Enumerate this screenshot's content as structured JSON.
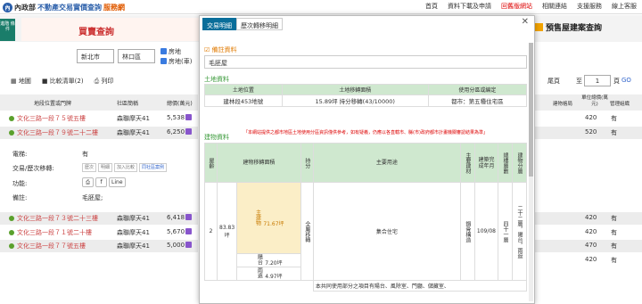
{
  "site": {
    "emblem": "內",
    "name_a": "內政部",
    "name_b": "不動產交易實價查詢",
    "name_c": "服務網"
  },
  "topnav": [
    "首頁",
    "資料下載及申請",
    "回舊版網站",
    "相關連結",
    "支援服務",
    "線上客服"
  ],
  "side_button": "進階\n條件",
  "banner": {
    "title": "買賣查詢",
    "presale": "預售屋建案查詢"
  },
  "filters": {
    "city": "新北市",
    "district": "林口區",
    "chk1": "房地",
    "chk2": "房地(車)"
  },
  "toolbar": {
    "map": "地圖",
    "compare": "比較清單(2)",
    "print": "列印"
  },
  "table_headers": {
    "address": "地段位置或門牌",
    "community": "社區簡稱",
    "price": "總價(萬元)"
  },
  "rows": [
    {
      "addr": "文化三路一段７５號五樓",
      "comm": "森聯摩天41",
      "price": "5,538"
    },
    {
      "addr": "文化三路一段７９號二十二樓",
      "comm": "森聯摩天41",
      "price": "6,250"
    },
    {
      "addr": "文化三路一段７３號二十三樓",
      "comm": "森聯摩天41",
      "price": "6,418"
    },
    {
      "addr": "文化三路一段７１號二十樓",
      "comm": "森聯摩天41",
      "price": "5,670"
    },
    {
      "addr": "文化三路一段７７號五樓",
      "comm": "森聯摩天41",
      "price": "5,000"
    }
  ],
  "detail": {
    "elevator_label": "電梯:",
    "elevator_value": "有",
    "history_label": "交易/歷次移轉:",
    "history_btns": [
      "歷次",
      "明細",
      "加入比較",
      "同社區案例"
    ],
    "func_label": "功能:",
    "line": "Line",
    "note_label": "備註:",
    "note_value": "毛胚屋;"
  },
  "right": {
    "last": "尾頁",
    "to": "至",
    "page": "1",
    "unit": "頁",
    "go": "GO",
    "h1": "建物格局",
    "h2": "單位總價(萬元)",
    "h3": "管理組織",
    "rows": [
      [
        "420",
        "有"
      ],
      [
        "520",
        "有"
      ],
      [
        "420",
        "有"
      ],
      [
        "420",
        "有"
      ],
      [
        "470",
        "有"
      ],
      [
        "420",
        "有"
      ]
    ]
  },
  "modal": {
    "tabs": [
      "交易明細",
      "歷次轉移明細"
    ],
    "note_title": "備註資料",
    "note_value": "毛胚屋",
    "land_title": "土地資料",
    "land_headers": [
      "土地位置",
      "土地移轉面積",
      "使用分區或編定"
    ],
    "land_row": [
      "建林段453地號",
      "15.89坪 持分移轉(43/10000)",
      "都市：第五種住宅區"
    ],
    "warning": "「本網站提供之都市地區土地使用分區資訊僅供參考，如有疑義，仍應以各直轄市、縣(市)政府都市計畫機關審認結果為準」",
    "bld_title": "建物資料",
    "bld_headers": [
      "屋齡",
      "建物移轉面積",
      "",
      "持分",
      "主要用途",
      "主要建材",
      "建築完成年月",
      "總樓層數",
      "建物分層"
    ],
    "bld_row": {
      "age": "2",
      "total": "83.83坪",
      "parts": [
        [
          "主建物",
          "71.67坪"
        ],
        [
          "陽台",
          "7.20坪"
        ],
        [
          "雨遮",
          "4.97坪"
        ]
      ],
      "share": "全屬移轉",
      "use": "集合住宅",
      "mat": "鋼骨構造",
      "built": "109/08",
      "floors": "四十一層",
      "layer": "二十二層，陽台，雨遮"
    },
    "common": "本共同使用部分之項目有陽台、風除室、門廳、儲藏室、"
  }
}
